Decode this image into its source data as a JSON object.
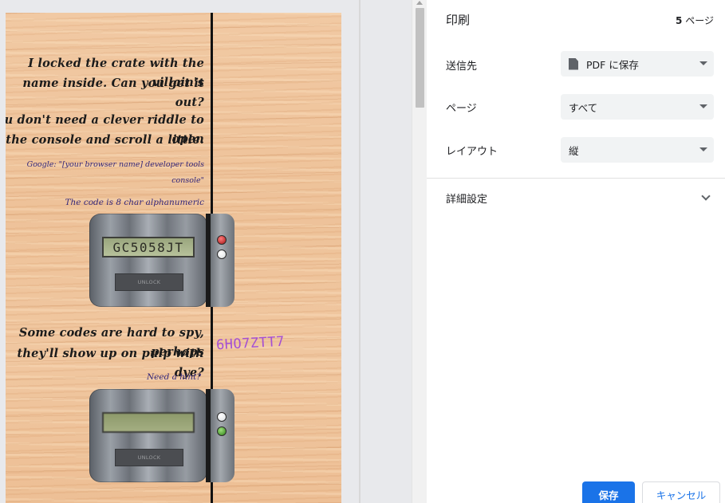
{
  "preview": {
    "puzzle1": {
      "line1": "I locked the crate with the villain's",
      "line2": "name inside. Can you get it out?",
      "line3": "You don't need a clever riddle to open",
      "line4": "the console and scroll a little.",
      "hint1": "Google: \"[your browser name] developer tools",
      "hint2": "console\"",
      "hint3": "The code is 8 char alphanumeric",
      "lcd_value": "GC5058JT",
      "unlock_label": "UNLOCK"
    },
    "puzzle2": {
      "line1": "Some codes are hard to spy, perhaps",
      "line2": "they'll show up on pulp with dye?",
      "hint": "Need a hint?",
      "stamp_code": "6HO7ZTT7",
      "lcd_value": "",
      "unlock_label": "UNLOCK"
    }
  },
  "settings": {
    "title": "印刷",
    "page_count": "5",
    "page_count_suffix": "ページ",
    "destination_label": "送信先",
    "destination_value": "PDF に保存",
    "pages_label": "ページ",
    "pages_value": "すべて",
    "layout_label": "レイアウト",
    "layout_value": "縦",
    "more_settings_label": "詳細設定",
    "save_label": "保存",
    "cancel_label": "キャンセル"
  },
  "colors": {
    "accent": "#1a73e8",
    "led_red": "#c42020",
    "led_green": "#3a9a1f",
    "stamp_purple": "#a44fd4"
  }
}
